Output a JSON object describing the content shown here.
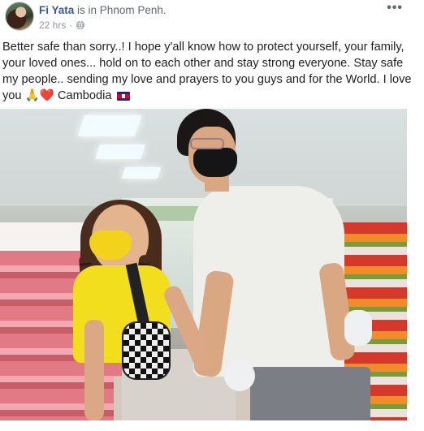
{
  "post": {
    "author": "Fi Yata",
    "location_text": "is in Phnom Penh.",
    "time": "22 hrs",
    "dot": "·",
    "more_icon": "more-icon",
    "more_label": "•••",
    "globe_icon": "globe-icon",
    "text_main": "Better safe than sorry..! I hope y'all know how to protect yourself, your family, your loved ones... hold on to each other and stay strong everyone. Stay safe my people.. sending my love and prayers to you guys and for the World. I love you ",
    "emoji_pray": "🙏",
    "emoji_heart": "❤️",
    "text_country": " Cambodia ",
    "flag_icon": "cambodia-flag-icon"
  },
  "colors": {
    "author": "#385898",
    "meta": "#90949c",
    "text": "#1c1e21"
  }
}
